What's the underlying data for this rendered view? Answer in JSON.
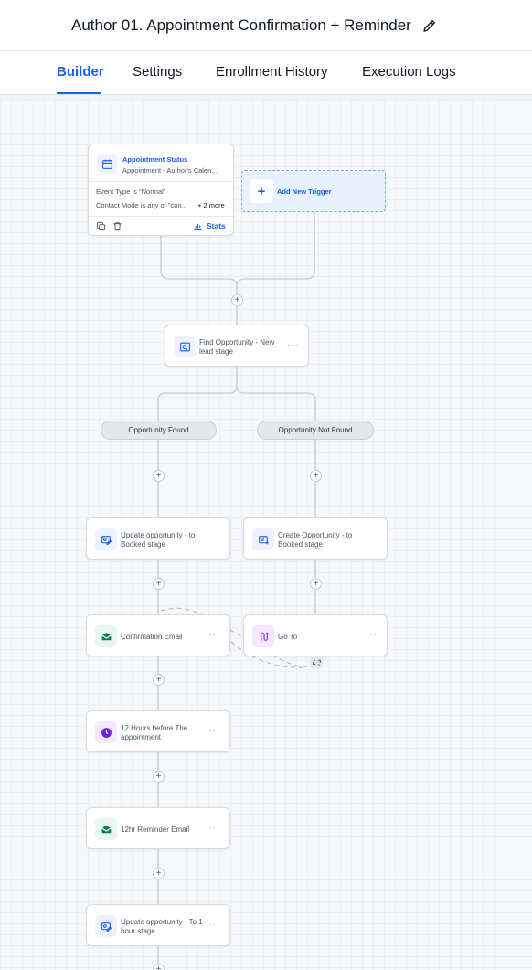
{
  "header": {
    "title": "Author 01. Appointment Confirmation + Reminder",
    "edit_icon": "pencil-icon"
  },
  "tabs": [
    {
      "label": "Builder",
      "active": true
    },
    {
      "label": "Settings",
      "active": false
    },
    {
      "label": "Enrollment History",
      "active": false
    },
    {
      "label": "Execution Logs",
      "active": false
    }
  ],
  "trigger": {
    "title": "Appointment Status",
    "subtitle": "Appointment - Author's Calen...",
    "condition_1": "Event Type is \"Normal\"",
    "condition_2": "Contact Mode is any of \"con...",
    "more_conditions": "+ 2 more",
    "stats_label": "Stats",
    "icon": "calendar-icon"
  },
  "add_trigger": {
    "label": "Add New Trigger"
  },
  "nodes": {
    "find_opportunity": {
      "label": "Find Opportunity - New lead stage",
      "icon": "search-icon"
    },
    "update_booked": {
      "label": "Update opportunity - to Booked stage",
      "icon": "opportunity-edit-icon"
    },
    "create_opportunity": {
      "label": "Create Opportunity - to Booked stage",
      "icon": "opportunity-add-icon"
    },
    "confirmation_email": {
      "label": "Confirmation Email",
      "icon": "email-icon"
    },
    "go_to": {
      "label": "Go To",
      "icon": "goto-icon"
    },
    "wait_12h": {
      "label": "12 Hours before The appointment",
      "icon": "clock-icon"
    },
    "reminder_email": {
      "label": "12hr Reminder Email",
      "icon": "email-icon"
    },
    "update_1h": {
      "label": "Update opportunity - To 1 hour stage",
      "icon": "opportunity-edit-icon"
    }
  },
  "branches": {
    "found": "Opportunity Found",
    "not_found": "Opportunity Not Found"
  },
  "colors": {
    "accent": "#155eef",
    "email_green": "#0f7b4f",
    "wait_purple": "#6d28d9",
    "goto_purple": "#9333ea"
  }
}
